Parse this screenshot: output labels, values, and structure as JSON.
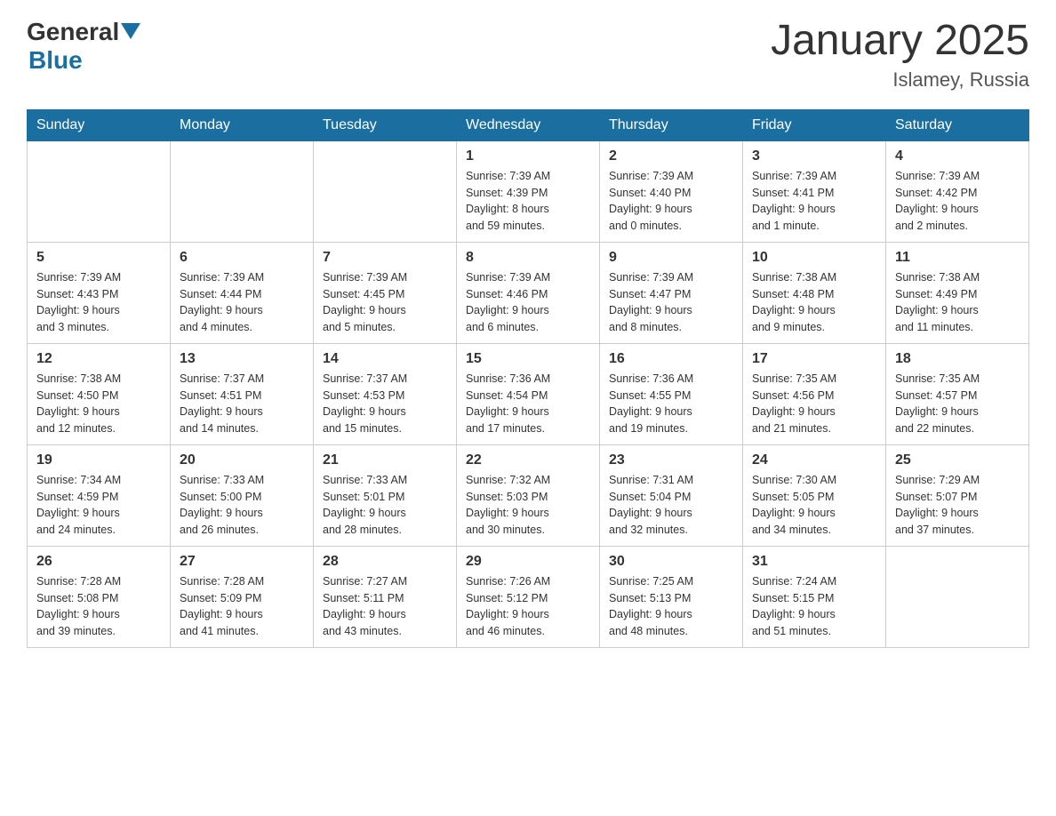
{
  "logo": {
    "general": "General",
    "blue": "Blue"
  },
  "title": "January 2025",
  "subtitle": "Islamey, Russia",
  "days_of_week": [
    "Sunday",
    "Monday",
    "Tuesday",
    "Wednesday",
    "Thursday",
    "Friday",
    "Saturday"
  ],
  "weeks": [
    [
      {
        "day": "",
        "info": ""
      },
      {
        "day": "",
        "info": ""
      },
      {
        "day": "",
        "info": ""
      },
      {
        "day": "1",
        "info": "Sunrise: 7:39 AM\nSunset: 4:39 PM\nDaylight: 8 hours\nand 59 minutes."
      },
      {
        "day": "2",
        "info": "Sunrise: 7:39 AM\nSunset: 4:40 PM\nDaylight: 9 hours\nand 0 minutes."
      },
      {
        "day": "3",
        "info": "Sunrise: 7:39 AM\nSunset: 4:41 PM\nDaylight: 9 hours\nand 1 minute."
      },
      {
        "day": "4",
        "info": "Sunrise: 7:39 AM\nSunset: 4:42 PM\nDaylight: 9 hours\nand 2 minutes."
      }
    ],
    [
      {
        "day": "5",
        "info": "Sunrise: 7:39 AM\nSunset: 4:43 PM\nDaylight: 9 hours\nand 3 minutes."
      },
      {
        "day": "6",
        "info": "Sunrise: 7:39 AM\nSunset: 4:44 PM\nDaylight: 9 hours\nand 4 minutes."
      },
      {
        "day": "7",
        "info": "Sunrise: 7:39 AM\nSunset: 4:45 PM\nDaylight: 9 hours\nand 5 minutes."
      },
      {
        "day": "8",
        "info": "Sunrise: 7:39 AM\nSunset: 4:46 PM\nDaylight: 9 hours\nand 6 minutes."
      },
      {
        "day": "9",
        "info": "Sunrise: 7:39 AM\nSunset: 4:47 PM\nDaylight: 9 hours\nand 8 minutes."
      },
      {
        "day": "10",
        "info": "Sunrise: 7:38 AM\nSunset: 4:48 PM\nDaylight: 9 hours\nand 9 minutes."
      },
      {
        "day": "11",
        "info": "Sunrise: 7:38 AM\nSunset: 4:49 PM\nDaylight: 9 hours\nand 11 minutes."
      }
    ],
    [
      {
        "day": "12",
        "info": "Sunrise: 7:38 AM\nSunset: 4:50 PM\nDaylight: 9 hours\nand 12 minutes."
      },
      {
        "day": "13",
        "info": "Sunrise: 7:37 AM\nSunset: 4:51 PM\nDaylight: 9 hours\nand 14 minutes."
      },
      {
        "day": "14",
        "info": "Sunrise: 7:37 AM\nSunset: 4:53 PM\nDaylight: 9 hours\nand 15 minutes."
      },
      {
        "day": "15",
        "info": "Sunrise: 7:36 AM\nSunset: 4:54 PM\nDaylight: 9 hours\nand 17 minutes."
      },
      {
        "day": "16",
        "info": "Sunrise: 7:36 AM\nSunset: 4:55 PM\nDaylight: 9 hours\nand 19 minutes."
      },
      {
        "day": "17",
        "info": "Sunrise: 7:35 AM\nSunset: 4:56 PM\nDaylight: 9 hours\nand 21 minutes."
      },
      {
        "day": "18",
        "info": "Sunrise: 7:35 AM\nSunset: 4:57 PM\nDaylight: 9 hours\nand 22 minutes."
      }
    ],
    [
      {
        "day": "19",
        "info": "Sunrise: 7:34 AM\nSunset: 4:59 PM\nDaylight: 9 hours\nand 24 minutes."
      },
      {
        "day": "20",
        "info": "Sunrise: 7:33 AM\nSunset: 5:00 PM\nDaylight: 9 hours\nand 26 minutes."
      },
      {
        "day": "21",
        "info": "Sunrise: 7:33 AM\nSunset: 5:01 PM\nDaylight: 9 hours\nand 28 minutes."
      },
      {
        "day": "22",
        "info": "Sunrise: 7:32 AM\nSunset: 5:03 PM\nDaylight: 9 hours\nand 30 minutes."
      },
      {
        "day": "23",
        "info": "Sunrise: 7:31 AM\nSunset: 5:04 PM\nDaylight: 9 hours\nand 32 minutes."
      },
      {
        "day": "24",
        "info": "Sunrise: 7:30 AM\nSunset: 5:05 PM\nDaylight: 9 hours\nand 34 minutes."
      },
      {
        "day": "25",
        "info": "Sunrise: 7:29 AM\nSunset: 5:07 PM\nDaylight: 9 hours\nand 37 minutes."
      }
    ],
    [
      {
        "day": "26",
        "info": "Sunrise: 7:28 AM\nSunset: 5:08 PM\nDaylight: 9 hours\nand 39 minutes."
      },
      {
        "day": "27",
        "info": "Sunrise: 7:28 AM\nSunset: 5:09 PM\nDaylight: 9 hours\nand 41 minutes."
      },
      {
        "day": "28",
        "info": "Sunrise: 7:27 AM\nSunset: 5:11 PM\nDaylight: 9 hours\nand 43 minutes."
      },
      {
        "day": "29",
        "info": "Sunrise: 7:26 AM\nSunset: 5:12 PM\nDaylight: 9 hours\nand 46 minutes."
      },
      {
        "day": "30",
        "info": "Sunrise: 7:25 AM\nSunset: 5:13 PM\nDaylight: 9 hours\nand 48 minutes."
      },
      {
        "day": "31",
        "info": "Sunrise: 7:24 AM\nSunset: 5:15 PM\nDaylight: 9 hours\nand 51 minutes."
      },
      {
        "day": "",
        "info": ""
      }
    ]
  ]
}
